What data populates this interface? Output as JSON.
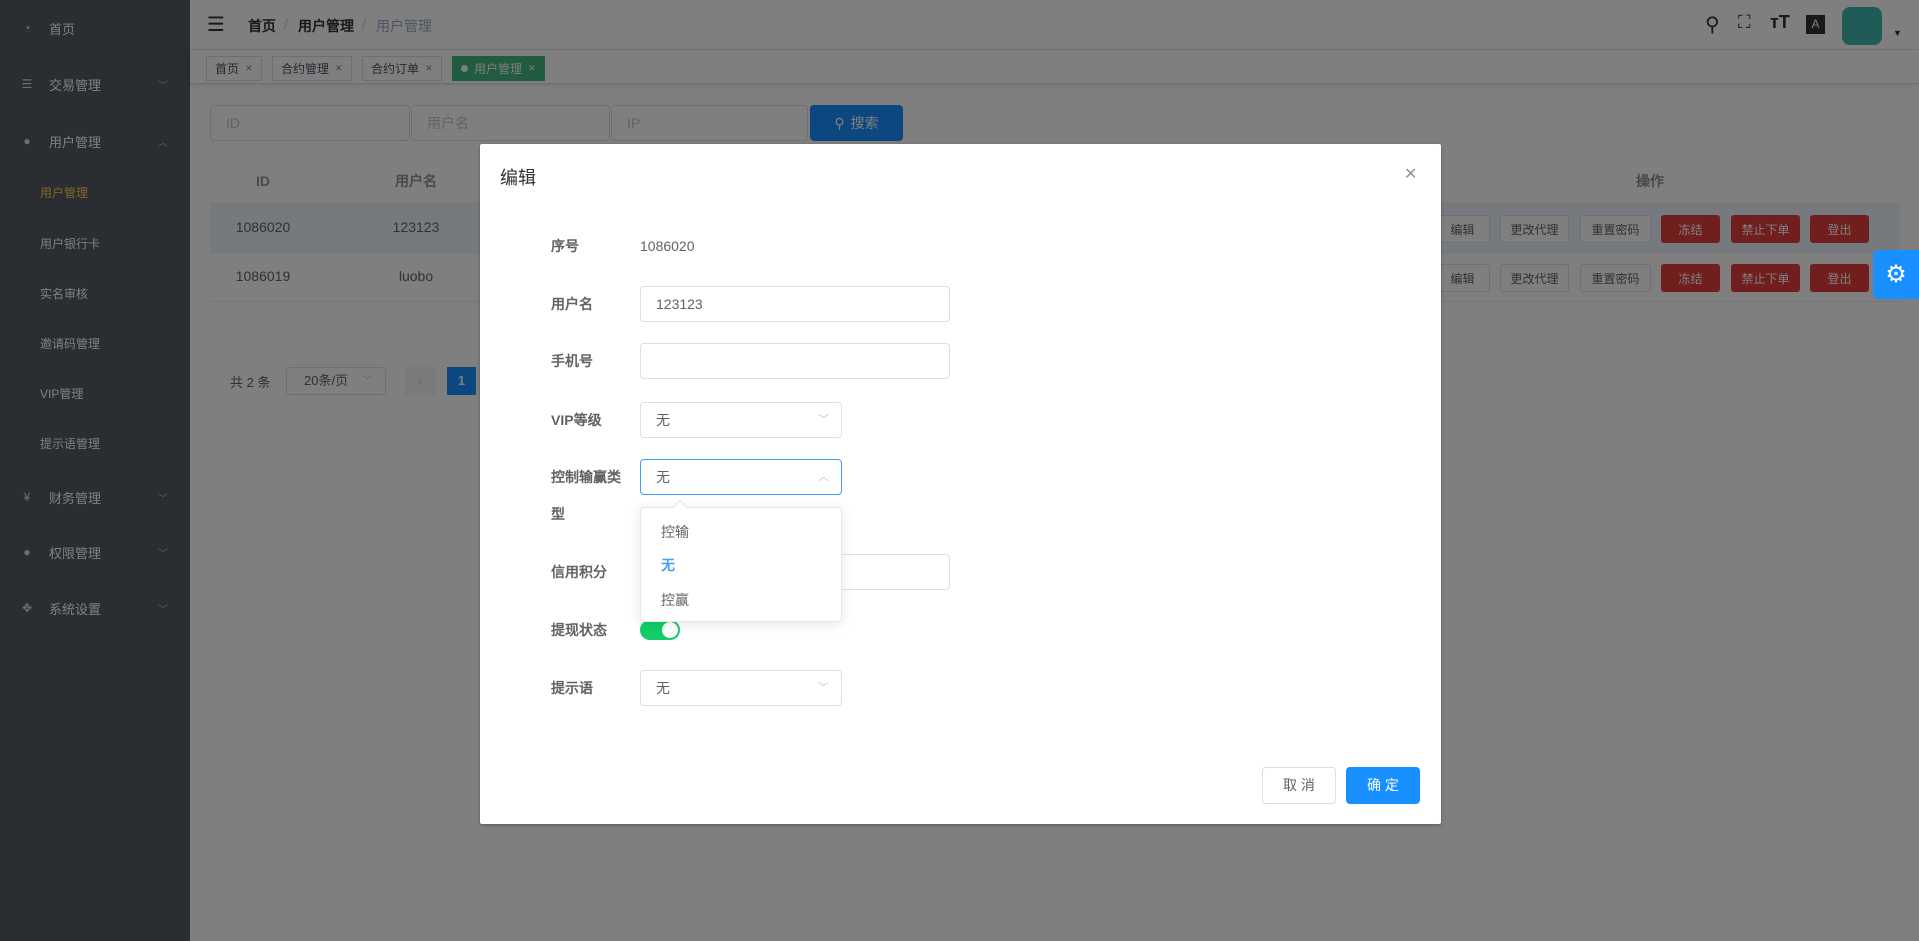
{
  "sidebar": {
    "items": [
      {
        "label": "首页",
        "icon": "dashboard-icon"
      },
      {
        "label": "交易管理",
        "icon": "list-icon"
      },
      {
        "label": "用户管理",
        "icon": "user-icon"
      },
      {
        "label": "财务管理",
        "icon": "yen-icon"
      },
      {
        "label": "权限管理",
        "icon": "person-icon"
      },
      {
        "label": "系统设置",
        "icon": "move-icon"
      }
    ],
    "sub_items": [
      "用户管理",
      "用户银行卡",
      "实名审核",
      "邀请码管理",
      "VIP管理",
      "提示语管理"
    ],
    "active_color": "#ffd04b"
  },
  "header": {
    "breadcrumb": [
      "首页",
      "用户管理",
      "用户管理"
    ],
    "separator": "/"
  },
  "tabs": [
    {
      "label": "首页"
    },
    {
      "label": "合约管理"
    },
    {
      "label": "合约订单"
    },
    {
      "label": "用户管理",
      "active": true
    }
  ],
  "search": {
    "id_placeholder": "ID",
    "username_placeholder": "用户名",
    "ip_placeholder": "IP",
    "button": "搜索"
  },
  "table": {
    "headers": {
      "id": "ID",
      "username": "用户名",
      "actions": "操作"
    },
    "rows": [
      {
        "id": "1086020",
        "username": "123123"
      },
      {
        "id": "1086019",
        "username": "luobo"
      }
    ],
    "actions": [
      "编辑",
      "更改代理",
      "重置密码",
      "冻结",
      "禁止下单",
      "登出"
    ]
  },
  "pagination": {
    "total": "共 2 条",
    "page_size": "20条/页",
    "current": "1"
  },
  "dialog": {
    "title": "编辑",
    "fields": {
      "seq_label": "序号",
      "seq_value": "1086020",
      "username_label": "用户名",
      "username_value": "123123",
      "phone_label": "手机号",
      "phone_value": "",
      "vip_label": "VIP等级",
      "vip_value": "无",
      "control_label_1": "控制输赢类",
      "control_label_2": "型",
      "control_value": "无",
      "credit_label": "信用积分",
      "withdraw_label": "提现状态",
      "withdraw_on": true,
      "hint_label": "提示语",
      "hint_value": "无"
    },
    "dropdown_options": [
      "控输",
      "无",
      "控赢"
    ],
    "cancel": "取 消",
    "confirm": "确 定"
  },
  "colors": {
    "primary": "#1890ff",
    "danger": "#e23c3c",
    "switch_on": "#13ce66",
    "tab_active": "#42b983"
  }
}
